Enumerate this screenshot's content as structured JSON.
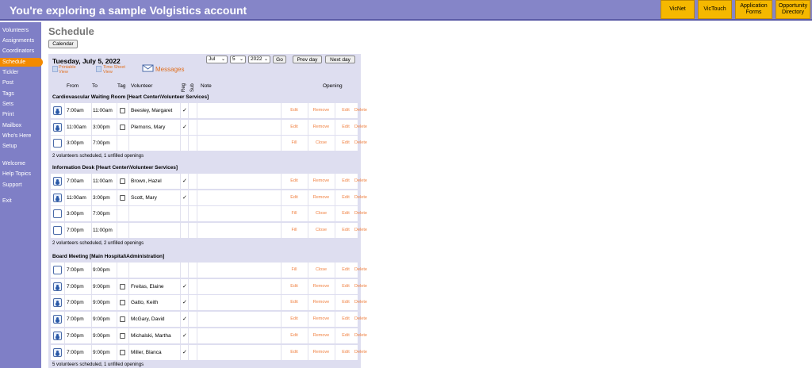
{
  "header": {
    "title": "You're exploring a sample Volgistics account",
    "buttons": [
      "VicNet",
      "VicTouch",
      "Application Forms",
      "Opportunity Directory"
    ]
  },
  "sidebar": {
    "items": [
      "Volunteers",
      "Assignments",
      "Coordinators",
      "Schedule",
      "Tickler",
      "Post",
      "Tags",
      "Sets",
      "Print",
      "Mailbox",
      "Who's Here",
      "Setup",
      "Welcome",
      "Help Topics",
      "Support",
      "Exit"
    ],
    "active": "Schedule"
  },
  "page": {
    "title": "Schedule",
    "calendar_button": "Calendar"
  },
  "schedule": {
    "date": "Tuesday, July 5, 2022",
    "month": "Jul",
    "day": "5",
    "year": "2022",
    "go": "Go",
    "prev_day": "Prev day",
    "next_day": "Next day",
    "printable_view": "Printable View",
    "time_sheet_view": "Time Sheet View",
    "messages": "Messages",
    "columns": {
      "from": "From",
      "to": "To",
      "tag": "Tag",
      "volunteer": "Volunteer",
      "reg": "Reg",
      "sub": "Sub",
      "note": "Note",
      "opening": "Opening"
    },
    "check": "✓",
    "sections": [
      {
        "title": "Cardiovascular Waiting Room [Heart Center\\Volunteer Services]",
        "rows": [
          {
            "from": "7:00am",
            "to": "11:00am",
            "volunteer": "Beesley, Margaret",
            "reg": "✓",
            "filled": true,
            "a1": "Edit",
            "a2": "Remove",
            "a3": "Edit",
            "a4": "Delete"
          },
          {
            "from": "11:00am",
            "to": "3:00pm",
            "volunteer": "Plemons, Mary",
            "reg": "✓",
            "filled": true,
            "a1": "Edit",
            "a2": "Remove",
            "a3": "Edit",
            "a4": "Delete"
          },
          {
            "from": "3:00pm",
            "to": "7:00pm",
            "volunteer": "",
            "reg": "",
            "filled": false,
            "a1": "Fill",
            "a2": "Close",
            "a3": "Edit",
            "a4": "Delete"
          }
        ],
        "summary": "2 volunteers scheduled, 1 unfilled openings"
      },
      {
        "title": "Information Desk [Heart Center\\Volunteer Services]",
        "rows": [
          {
            "from": "7:00am",
            "to": "11:00am",
            "volunteer": "Brown, Hazel",
            "reg": "✓",
            "filled": true,
            "a1": "Edit",
            "a2": "Remove",
            "a3": "Edit",
            "a4": "Delete"
          },
          {
            "from": "11:00am",
            "to": "3:00pm",
            "volunteer": "Scott, Mary",
            "reg": "✓",
            "filled": true,
            "a1": "Edit",
            "a2": "Remove",
            "a3": "Edit",
            "a4": "Delete"
          },
          {
            "from": "3:00pm",
            "to": "7:00pm",
            "volunteer": "",
            "reg": "",
            "filled": false,
            "a1": "Fill",
            "a2": "Close",
            "a3": "Edit",
            "a4": "Delete"
          },
          {
            "from": "7:00pm",
            "to": "11:00pm",
            "volunteer": "",
            "reg": "",
            "filled": false,
            "a1": "Fill",
            "a2": "Close",
            "a3": "Edit",
            "a4": "Delete"
          }
        ],
        "summary": "2 volunteers scheduled, 2 unfilled openings"
      },
      {
        "title": "Board Meeting [Main Hospital\\Administration]",
        "rows": [
          {
            "from": "7:00pm",
            "to": "9:00pm",
            "volunteer": "",
            "reg": "",
            "filled": false,
            "a1": "Fill",
            "a2": "Close",
            "a3": "Edit",
            "a4": "Delete"
          },
          {
            "from": "7:00pm",
            "to": "9:00pm",
            "volunteer": "Freitas, Elaine",
            "reg": "✓",
            "filled": true,
            "a1": "Edit",
            "a2": "Remove",
            "a3": "Edit",
            "a4": "Delete"
          },
          {
            "from": "7:00pm",
            "to": "9:00pm",
            "volunteer": "Gatto, Keith",
            "reg": "✓",
            "filled": true,
            "a1": "Edit",
            "a2": "Remove",
            "a3": "Edit",
            "a4": "Delete"
          },
          {
            "from": "7:00pm",
            "to": "9:00pm",
            "volunteer": "McGary, David",
            "reg": "✓",
            "filled": true,
            "a1": "Edit",
            "a2": "Remove",
            "a3": "Edit",
            "a4": "Delete"
          },
          {
            "from": "7:00pm",
            "to": "9:00pm",
            "volunteer": "Michalski, Martha",
            "reg": "✓",
            "filled": true,
            "a1": "Edit",
            "a2": "Remove",
            "a3": "Edit",
            "a4": "Delete"
          },
          {
            "from": "7:00pm",
            "to": "9:00pm",
            "volunteer": "Miller, Blanca",
            "reg": "✓",
            "filled": true,
            "a1": "Edit",
            "a2": "Remove",
            "a3": "Edit",
            "a4": "Delete"
          }
        ],
        "summary": "5 volunteers scheduled, 1 unfilled openings"
      }
    ]
  }
}
